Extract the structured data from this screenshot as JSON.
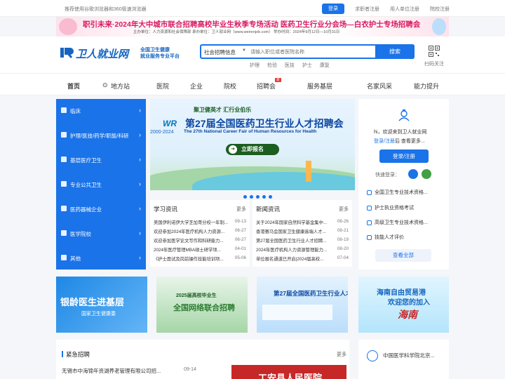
{
  "topbar": {
    "tip": "推荐使用谷歌浏览器和360极速浏览器",
    "login": "登录",
    "links": [
      "求职者注册",
      "用人单位注册",
      "院校注册"
    ]
  },
  "banner": {
    "line1": "职引未来·2024年大中城市联合招聘高校毕业生秋季专场活动   医药卫生行业分会场—白衣护士专场招聘会",
    "line2": "主办单位：人力资源和社会保障部   承办单位：卫人就业网（www.weirenjob.com）   举办时间：2024年9月12日—10月31日"
  },
  "header": {
    "logo_text": "卫人就业网",
    "slogan1": "全国卫生健康",
    "slogan2": "就业服务专业平台",
    "search_category": "社会招聘信息",
    "search_placeholder": "请输入职位或者医院名称",
    "search_button": "搜索",
    "hot": [
      "护理",
      "检验",
      "医技",
      "护士",
      "康复"
    ],
    "qr_label": "扫码关注"
  },
  "nav": {
    "items": [
      "首页",
      "地方站",
      "医院",
      "企业",
      "院校",
      "招聘会",
      "服务基层",
      "名家风采",
      "能力提升"
    ],
    "new_badge": "新"
  },
  "left_menu": [
    "临床",
    "护理/医技/药学/职能/科研",
    "基层医疗卫生",
    "专业公共卫生",
    "医药器械企业",
    "医学院校",
    "其他"
  ],
  "carousel": {
    "tag": "聚卫健英才  汇行业伯乐",
    "title": "第27届全国医药卫生行业人才招聘会",
    "en": "The 27th National Career Fair of Human Resources for Health",
    "years": "2000-2024",
    "logo": "WR",
    "register": "立即报名"
  },
  "study": {
    "title": "学习资讯",
    "more": "更多",
    "rows": [
      {
        "t": "美国伊利诺伊大学芝加哥分校一年制...",
        "d": "09-13"
      },
      {
        "t": "欢迎参加2024年医疗机构人力资源...",
        "d": "06-27"
      },
      {
        "t": "欢迎参加医学论文写作和科研能力...",
        "d": "06-27"
      },
      {
        "t": "2024年医疗管理MBA硕士研学项...",
        "d": "04-01"
      },
      {
        "t": "《护士面试及岗前操作技能培训项...",
        "d": "05-06"
      }
    ]
  },
  "news": {
    "title": "新闻资讯",
    "more": "更多",
    "rows": [
      {
        "t": "关于2024年国家自然科学基金集中...",
        "d": "08-26"
      },
      {
        "t": "香港赛马会国家卫生健康高端人才...",
        "d": "08-21"
      },
      {
        "t": "第27届全国医药卫生行业人才招聘...",
        "d": "08-19"
      },
      {
        "t": "2024年医疗机构人力资源管理能力...",
        "d": "08-20"
      },
      {
        "t": "单位报名通道已开启|2024届高校...",
        "d": "07-04"
      }
    ]
  },
  "user": {
    "hi": "hi，欢迎来到卫人就业网",
    "reg_a": "登录/注册",
    "reg_b": "后 查看更多...",
    "login_btn": "登录/注册",
    "quick": "快速登录：",
    "services": [
      "全国卫生专业技术资格...",
      "护士执业资格考试",
      "高级卫生专业技术资格...",
      "技能人才评价"
    ],
    "view_all": "查看全部"
  },
  "ads": {
    "ad1_a": "银龄医生进基层",
    "ad1_b": "国家卫生健康委",
    "ad2_b": "2025届高校毕业生",
    "ad2_a": "全国网络联合招聘",
    "ad3_a": "第27届全国医药卫生行业人才招聘会",
    "ad4_a": "海南自由贸易港",
    "ad4_b": "欢迎您的加入",
    "ad4_c": "海南"
  },
  "urgent": {
    "title": "紧急招聘",
    "more": "更多",
    "job": "无锡市中海锦年资湖养老管理有限公司招...",
    "date": "09-14",
    "redad": "工安县人民医院"
  },
  "org": {
    "name": "中国医学科学院北京..."
  },
  "colors": {
    "primary": "#1a73e8",
    "banner_text": "#d81b60"
  }
}
